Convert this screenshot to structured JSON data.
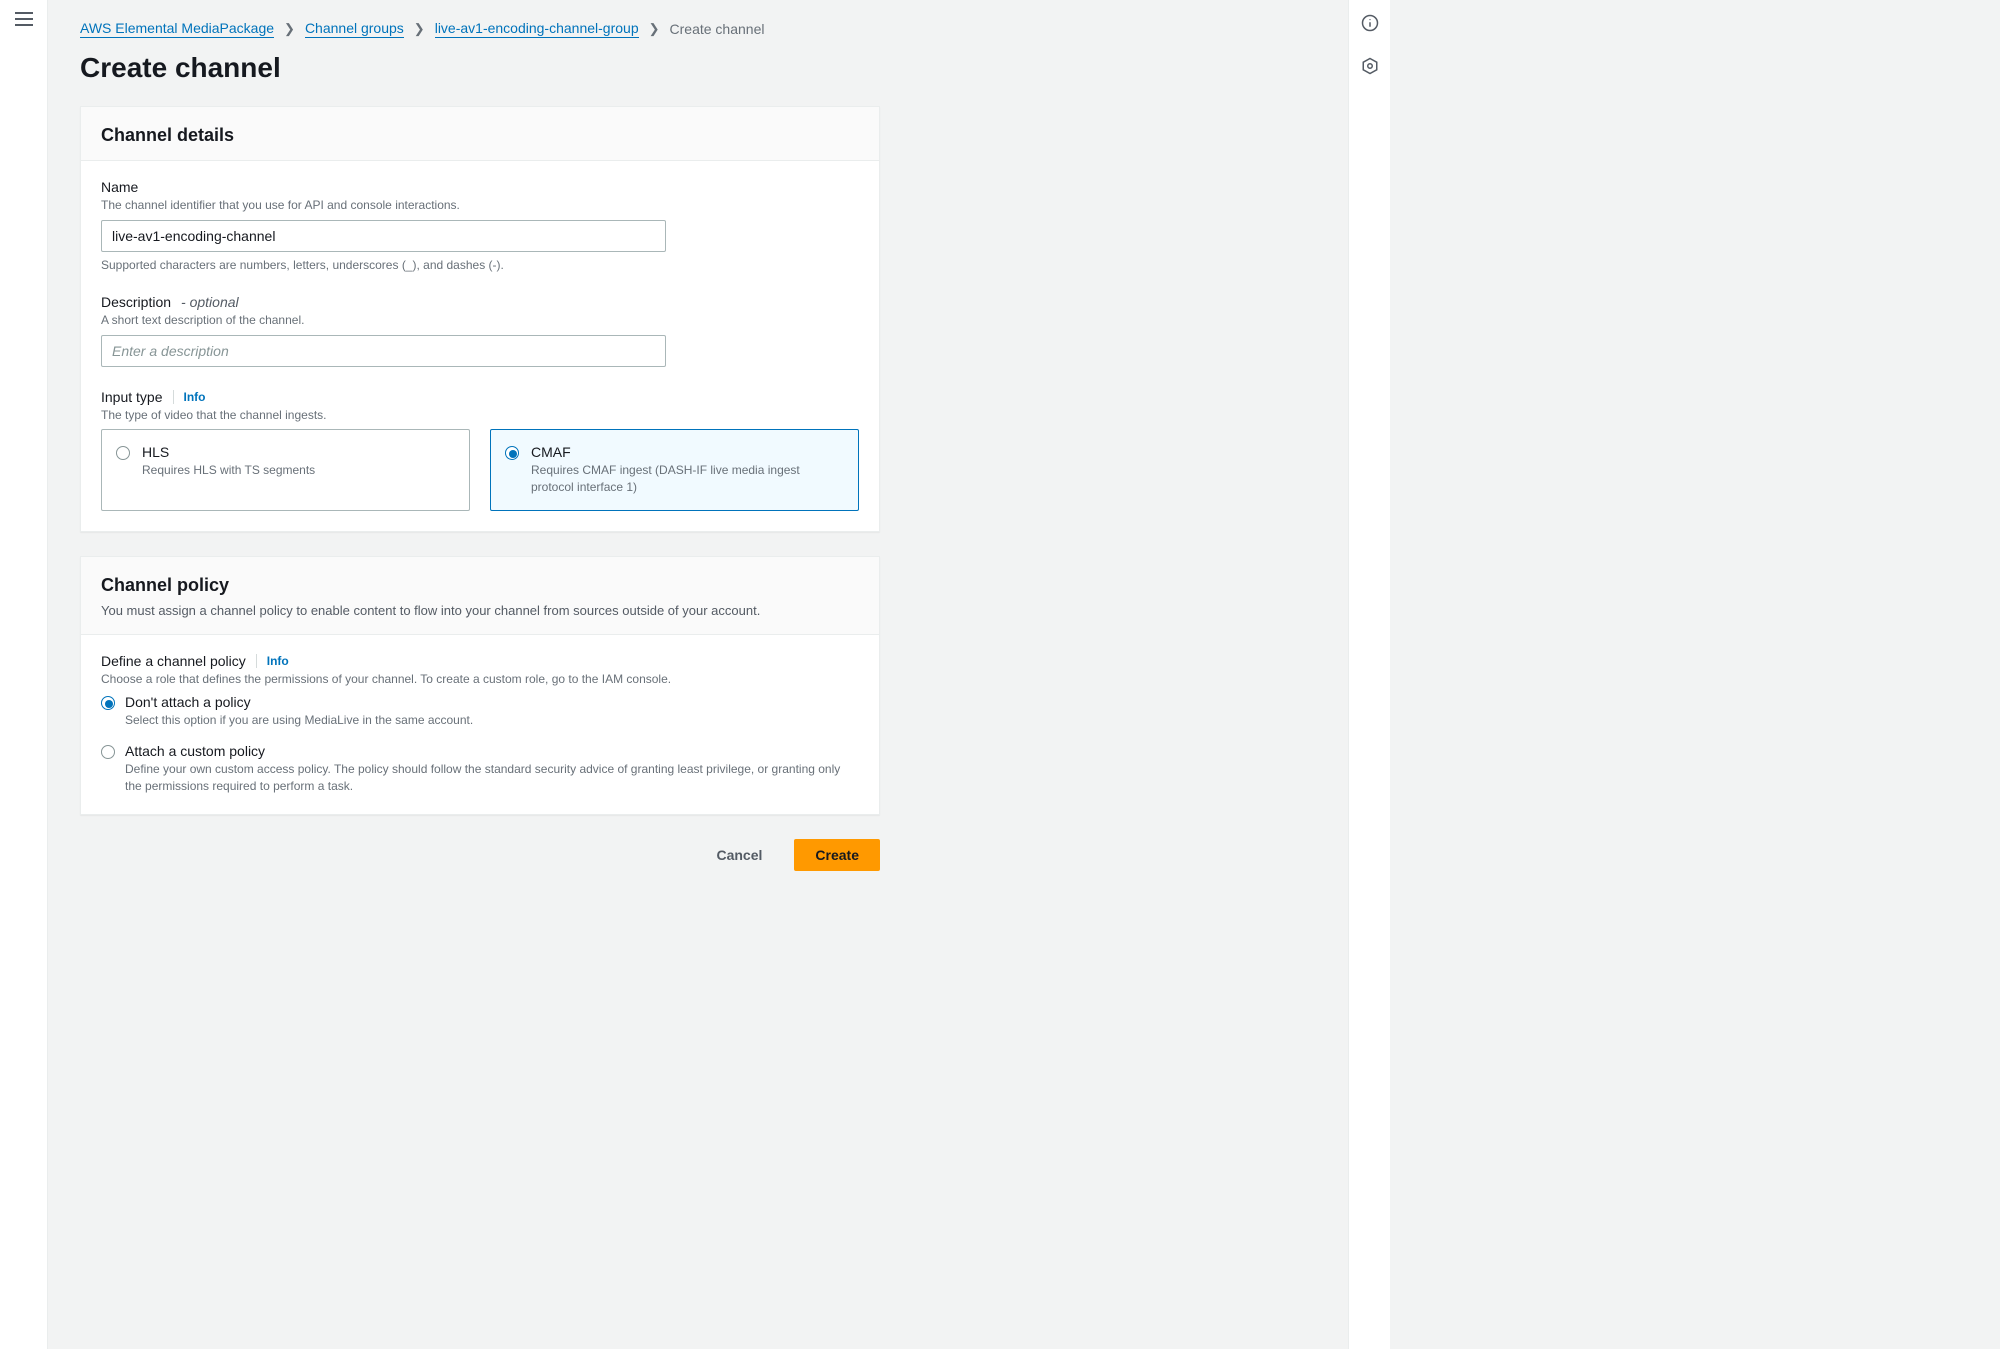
{
  "breadcrumbs": {
    "items": [
      {
        "label": "AWS Elemental MediaPackage",
        "link": true
      },
      {
        "label": "Channel groups",
        "link": true
      },
      {
        "label": "live-av1-encoding-channel-group",
        "link": true
      },
      {
        "label": "Create channel",
        "link": false
      }
    ]
  },
  "page": {
    "title": "Create channel"
  },
  "details": {
    "heading": "Channel details",
    "name": {
      "label": "Name",
      "hint": "The channel identifier that you use for API and console interactions.",
      "value": "live-av1-encoding-channel",
      "constraint": "Supported characters are numbers, letters, underscores (_), and dashes (-)."
    },
    "description": {
      "label": "Description",
      "optional": "- optional",
      "hint": "A short text description of the channel.",
      "placeholder": "Enter a description",
      "value": ""
    },
    "input_type": {
      "label": "Input type",
      "info": "Info",
      "hint": "The type of video that the channel ingests.",
      "options": [
        {
          "title": "HLS",
          "desc": "Requires HLS with TS segments",
          "selected": false
        },
        {
          "title": "CMAF",
          "desc": "Requires CMAF ingest (DASH-IF live media ingest protocol interface 1)",
          "selected": true
        }
      ]
    }
  },
  "policy": {
    "heading": "Channel policy",
    "subtitle": "You must assign a channel policy to enable content to flow into your channel from sources outside of your account.",
    "define": {
      "label": "Define a channel policy",
      "info": "Info",
      "hint": "Choose a role that defines the permissions of your channel. To create a custom role, go to the IAM console.",
      "options": [
        {
          "title": "Don't attach a policy",
          "desc": "Select this option if you are using MediaLive in the same account.",
          "selected": true
        },
        {
          "title": "Attach a custom policy",
          "desc": "Define your own custom access policy. The policy should follow the standard security advice of granting least privilege, or granting only the permissions required to perform a task.",
          "selected": false
        }
      ]
    }
  },
  "actions": {
    "cancel": "Cancel",
    "create": "Create"
  }
}
